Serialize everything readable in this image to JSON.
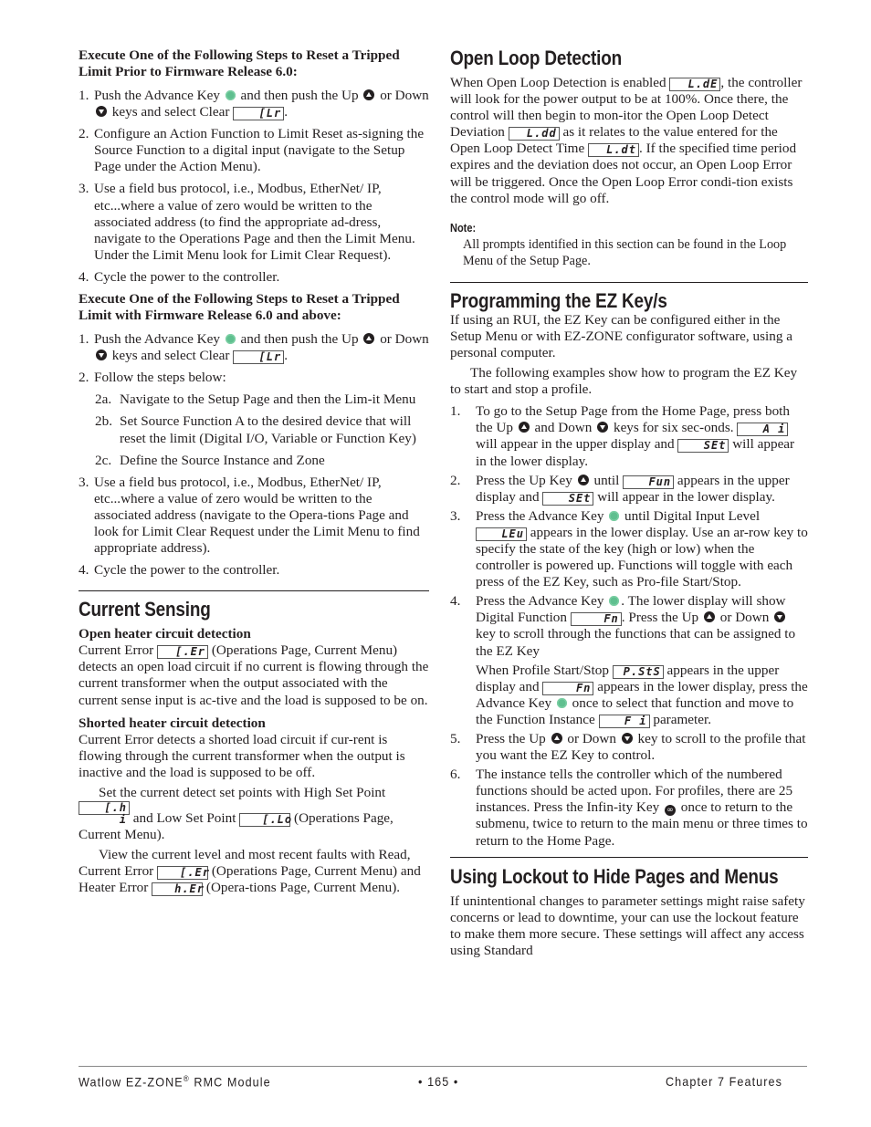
{
  "left": {
    "reset_prior": {
      "heading": "Execute One of the Following Steps to Reset a Tripped Limit Prior to Firmware Release 6.0:",
      "steps": [
        {
          "num": "1.",
          "pre": "Push the Advance Key",
          "mid1": "and then push the Up",
          "mid2": "or Down",
          "mid3": "keys and select Clear",
          "display": "[Lr",
          "post": "."
        },
        {
          "num": "2.",
          "text": "Configure an Action Function to Limit Reset as-signing the Source Function to a digital input (navigate to the Setup Page under the Action Menu)."
        },
        {
          "num": "3.",
          "text": "Use a field bus protocol, i.e., Modbus, EtherNet/ IP, etc...where a value of zero would be written to the associated address (to find the appropriate ad-dress, navigate to the Operations Page and then the Limit Menu. Under the Limit Menu look for Limit Clear Request)."
        },
        {
          "num": "4.",
          "text": "Cycle the power to the controller."
        }
      ]
    },
    "reset_after": {
      "heading": "Execute One of the Following Steps to Reset a Tripped Limit with Firmware Release 6.0 and above:",
      "steps": [
        {
          "num": "1.",
          "pre": "Push the Advance Key",
          "mid1": "and then push the Up",
          "mid2": "or Down",
          "mid3": "keys and select Clear",
          "display": "[Lr",
          "post": "."
        },
        {
          "num": "2.",
          "text": "Follow the steps below:"
        },
        {
          "num": "3.",
          "text": "Use a field bus protocol, i.e., Modbus, EtherNet/ IP, etc...where a value of zero would be written to the associated address (navigate to the Opera-tions Page and look for Limit Clear Request under the Limit Menu to find appropriate address)."
        },
        {
          "num": "4.",
          "text": "Cycle the power to the controller."
        }
      ],
      "substeps": [
        {
          "num": "2a.",
          "text": "Navigate to the Setup Page and then the Lim-it Menu"
        },
        {
          "num": "2b.",
          "text": "Set Source Function A to the desired device that will reset the limit (Digital I/O, Variable or Function Key)"
        },
        {
          "num": "2c.",
          "text": "Define the Source Instance and Zone"
        }
      ]
    },
    "current_sensing": {
      "title": "Current Sensing",
      "open_heading": "Open heater circuit detection",
      "open_pre": "Current Error",
      "open_display": "[.Er",
      "open_post": "(Operations Page, Current Menu) detects an open load circuit if no current is flowing through the current transformer when the output associated with the current sense input is ac-tive and the load is supposed to be on.",
      "shorted_heading": "Shorted heater circuit detection",
      "shorted_text": "Current Error detects a shorted load circuit if cur-rent is flowing through the current transformer when the output is inactive and the load is supposed to be off.",
      "setpoints_pre": "Set the current detect set points with High Set Point",
      "setpoints_display1": "[.h i",
      "setpoints_mid": "and Low Set Point",
      "setpoints_display2": "[.Lo",
      "setpoints_post": "(Operations Page, Current Menu).",
      "view_pre": "View the current level and most recent faults with Read, Current Error",
      "view_display1": "[.Er",
      "view_mid": "(Operations Page, Current Menu) and Heater Error",
      "view_display2": "h.Er",
      "view_post": "(Opera-tions Page, Current Menu)."
    }
  },
  "right": {
    "open_loop": {
      "title": "Open Loop Detection",
      "p1": "When Open Loop Detection is enabled",
      "d1": "L.dE",
      "p2": ", the controller will look for the power output to be at 100%. Once there, the control will then begin to mon-itor the Open Loop Detect Deviation",
      "d2": "L.dd",
      "p3": "as it relates to the value entered for the Open Loop Detect Time",
      "d3": "L.dt",
      "p4": ". If the specified time period expires and the deviation does not occur, an Open Loop Error will be triggered. Once the Open Loop Error condi-tion exists the control mode will go off.",
      "note_label": "Note:",
      "note_text": "All prompts identified in this section can be found in the Loop Menu of the Setup Page."
    },
    "ez_key": {
      "title": "Programming the EZ Key/s",
      "intro": "If using an RUI, the EZ Key can be configured either in the Setup Menu or with EZ-ZONE configurator software, using a personal computer.",
      "intro2": "The following examples show how to program the EZ Key to start and stop a profile.",
      "s1": {
        "num": "1.",
        "a": "To go to the Setup Page from the Home Page, press both the Up",
        "b": "and Down",
        "c": "keys for six sec-onds.",
        "d1": "A i",
        "e": "will appear in the upper display and",
        "d2": "SEt",
        "f": "will appear in the lower display."
      },
      "s2": {
        "num": "2.",
        "a": "Press the Up Key",
        "b": "until",
        "d1": "Fun",
        "c": "appears in the upper display and",
        "d2": "SEt",
        "e": "will appear in the lower display."
      },
      "s3": {
        "num": "3.",
        "a": "Press the Advance Key",
        "b": "until Digital Input Level",
        "d1": "LEu",
        "c": "appears in the lower display. Use an ar-row key to specify the state of the key (high or low) when the controller is powered up. Functions will toggle with each press of the EZ Key, such as Pro-file Start/Stop."
      },
      "s4": {
        "num": "4.",
        "a": "Press the Advance Key",
        "b": ". The lower display will show Digital Function",
        "d1": "Fn",
        "c": ". Press the Up",
        "d": "or Down",
        "e": "key to scroll through the functions that can be assigned to the EZ Key",
        "f": "When Profile Start/Stop",
        "d2": "P.StS",
        "g": "appears in the upper display and",
        "d3": "Fn",
        "h": "appears in the lower display, press the Advance Key",
        "i": "once to select that function and move to the Function Instance",
        "d4": "F i",
        "j": "parameter."
      },
      "s5": {
        "num": "5.",
        "a": "Press the Up",
        "b": "or Down",
        "c": "key to scroll to the profile that you want the EZ Key to control."
      },
      "s6": {
        "num": "6.",
        "a": "The instance tells the controller which of the numbered functions should be acted upon. For profiles, there are 25 instances. Press the Infin-ity Key",
        "b": "once to return to the submenu, twice to return to the main menu or three times to return to the Home Page."
      }
    },
    "lockout": {
      "title": "Using Lockout to Hide Pages and Menus",
      "text": "If unintentional changes to parameter settings might raise safety concerns or lead to downtime, your can use the lockout feature to make them more secure. These settings will affect any access using Standard"
    }
  },
  "footer": {
    "product": "Watlow EZ-ZONE",
    "registered": "®",
    "product_suffix": " RMC Module",
    "page": "•  165  •",
    "chapter": "Chapter 7 Features"
  },
  "colors": {
    "advance_key": "#5fbf8f",
    "text": "#231f20"
  }
}
